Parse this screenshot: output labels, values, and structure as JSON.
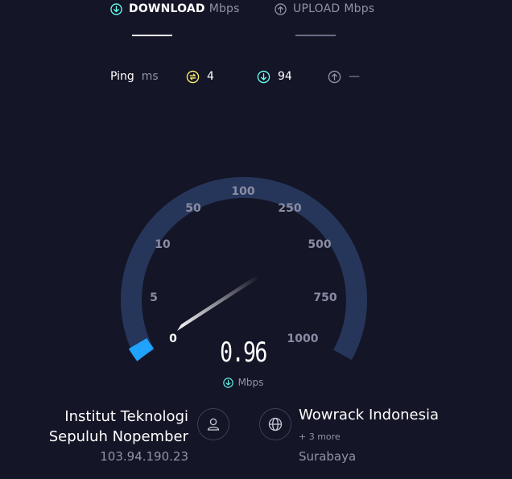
{
  "tabs": {
    "download": {
      "label": "DOWNLOAD",
      "unit": "Mbps",
      "icon": "download-arrow-icon"
    },
    "upload": {
      "label": "UPLOAD",
      "unit": "Mbps",
      "icon": "upload-arrow-icon"
    }
  },
  "ping": {
    "label": "Ping",
    "unit": "ms",
    "idle_value": "4",
    "download_value": "94",
    "upload_value": "—"
  },
  "gauge": {
    "ticks": [
      "0",
      "5",
      "10",
      "50",
      "100",
      "250",
      "500",
      "750",
      "1000"
    ],
    "speed": "0.96",
    "unit": "Mbps",
    "accent_color": "#1fa3ff",
    "track_color": "#26365a"
  },
  "provider": {
    "name_line1": "Institut Teknologi",
    "name_line2": "Sepuluh Nopember",
    "ip": "103.94.190.23",
    "icon": "user-icon"
  },
  "server": {
    "name": "Wowrack Indonesia",
    "more": "+ 3 more",
    "location": "Surabaya",
    "icon": "globe-icon"
  },
  "colors": {
    "background": "#141526",
    "muted": "#9193a8",
    "download_accent": "#6afff3",
    "idle_ping": "#fff36b"
  }
}
